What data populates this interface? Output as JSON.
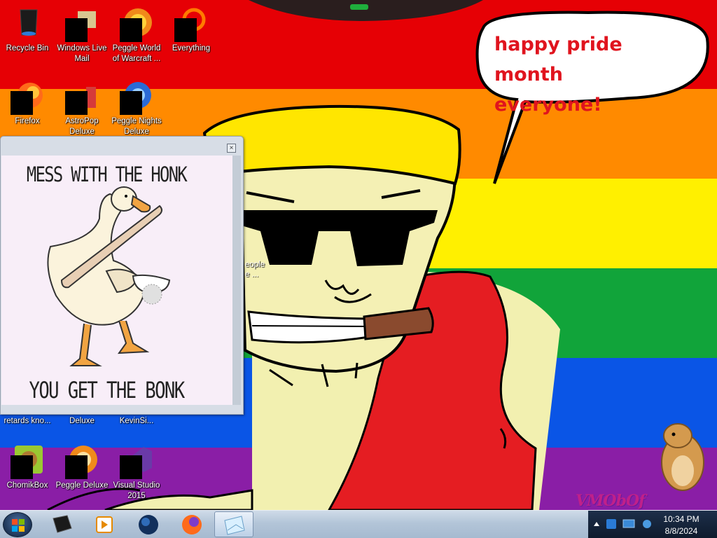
{
  "wallpaper": {
    "speech_bubble": [
      "happy pride month",
      "everyone!"
    ],
    "watermark": "VMObOf",
    "stripe_colors": [
      "#e60005",
      "#ff8a00",
      "#fff000",
      "#11a43a",
      "#0a55e6",
      "#8a1ea6"
    ]
  },
  "desktop_icons": [
    {
      "label": "Recycle Bin",
      "icon": "recycle-bin-icon"
    },
    {
      "label": "Windows Live Mail",
      "icon": "mail-icon"
    },
    {
      "label": "Peggle World of Warcraft ...",
      "icon": "peggle-icon"
    },
    {
      "label": "Everything",
      "icon": "search-icon"
    },
    {
      "label": "Firefox",
      "icon": "firefox-icon"
    },
    {
      "label": "AstroPop Deluxe",
      "icon": "astropop-icon"
    },
    {
      "label": "Peggle Nights Deluxe",
      "icon": "peggle-icon"
    },
    {
      "label": "retards kno...",
      "icon": "shortcut-icon"
    },
    {
      "label": "Deluxe",
      "icon": "shortcut-icon"
    },
    {
      "label": "KevinSi...",
      "icon": "shortcut-icon"
    },
    {
      "label": "ChomikBox",
      "icon": "chomikbox-icon"
    },
    {
      "label": "Peggle Deluxe",
      "icon": "peggle-icon"
    },
    {
      "label": "Visual Studio 2015",
      "icon": "visual-studio-icon"
    }
  ],
  "photo_gadget": {
    "close_glyph": "×",
    "top_text": "MESS WITH THE HONK",
    "bottom_text": "YOU GET THE BONK"
  },
  "hidden_icon_label": [
    "eople",
    "e ..."
  ],
  "taskbar": {
    "items": [
      "start-orb",
      "media-center",
      "media-player",
      "globe",
      "firefox",
      "photo-viewer"
    ],
    "tray_icons": [
      "show-hidden-icons",
      "network-icon",
      "display-icon",
      "speaker-icon"
    ]
  },
  "clock": {
    "time": "10:34 PM",
    "date": "8/8/2024"
  }
}
